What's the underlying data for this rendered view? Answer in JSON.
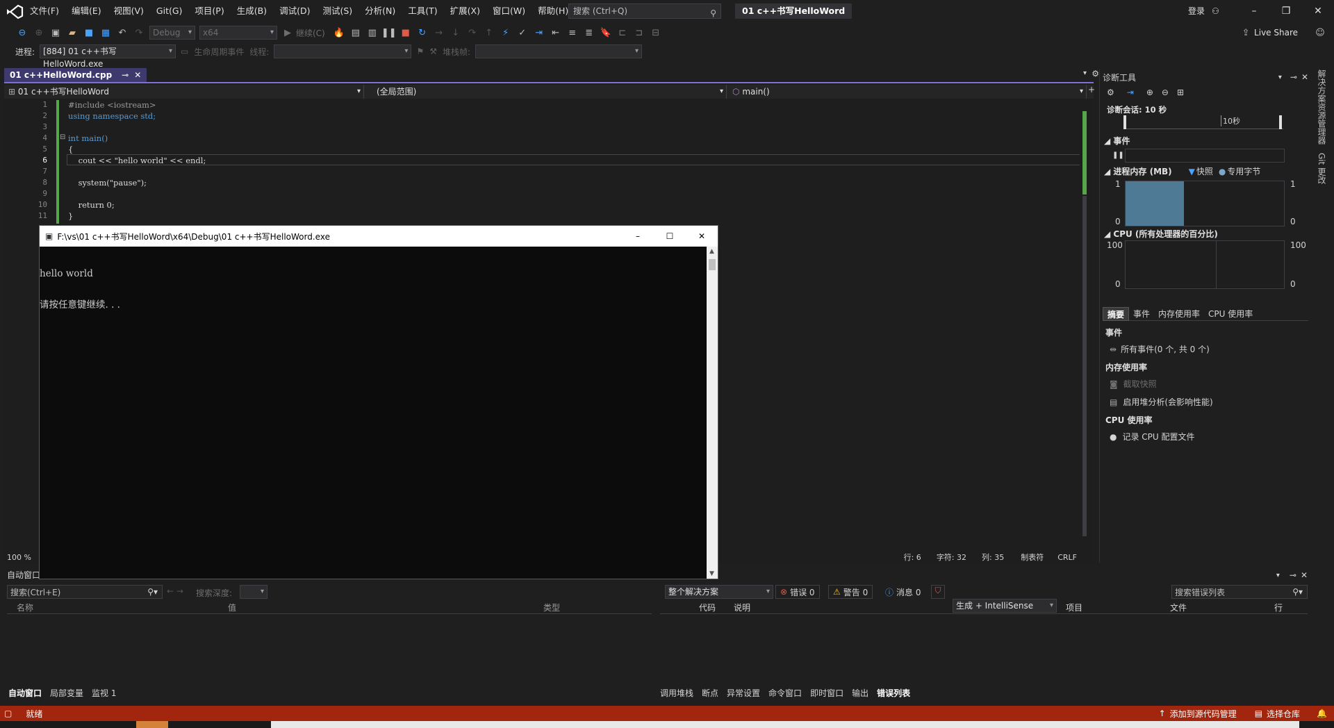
{
  "titlebar": {
    "menu": [
      "文件(F)",
      "编辑(E)",
      "视图(V)",
      "Git(G)",
      "项目(P)",
      "生成(B)",
      "调试(D)",
      "测试(S)",
      "分析(N)",
      "工具(T)",
      "扩展(X)",
      "窗口(W)",
      "帮助(H)"
    ],
    "search_placeholder": "搜索 (Ctrl+Q)",
    "solution_name": "01 c++书写HelloWord",
    "login": "登录"
  },
  "toolbar": {
    "config": "Debug",
    "platform": "x64",
    "continue_label": "继续(C)",
    "live_share": "Live Share",
    "process_label": "进程:",
    "process_value": "[884] 01 c++书写HelloWord.exe",
    "lifecycle_label": "生命周期事件",
    "thread_label": "线程:",
    "stackframe_label": "堆栈帧:"
  },
  "editor": {
    "tab_title": "01 c++HelloWord.cpp",
    "nav_project": "01 c++书写HelloWord",
    "nav_scope": "(全局范围)",
    "nav_member": "main()",
    "lines": [
      {
        "n": "1",
        "text": "#include <iostream>"
      },
      {
        "n": "2",
        "text": "using namespace std;"
      },
      {
        "n": "3",
        "text": ""
      },
      {
        "n": "4",
        "text": "int main()"
      },
      {
        "n": "5",
        "text": "{"
      },
      {
        "n": "6",
        "text": "    cout << \"hello world\" << endl;"
      },
      {
        "n": "7",
        "text": ""
      },
      {
        "n": "8",
        "text": "    system(\"pause\");"
      },
      {
        "n": "9",
        "text": ""
      },
      {
        "n": "10",
        "text": "    return 0;"
      },
      {
        "n": "11",
        "text": "}"
      }
    ],
    "zoom": "100 %",
    "status": {
      "line": "行: 6",
      "char": "字符: 32",
      "col": "列: 35",
      "tabs": "制表符",
      "eol": "CRLF"
    }
  },
  "console": {
    "title": "F:\\vs\\01 c++书写HelloWord\\x64\\Debug\\01 c++书写HelloWord.exe",
    "output_line1": "hello world",
    "output_line2": "请按任意键继续. . ."
  },
  "diagnostics": {
    "title": "诊断工具",
    "session": "诊断会话: 10 秒",
    "timeline_mark": "10秒",
    "events_header": "事件",
    "memory_header": "进程内存 (MB)",
    "legend_snapshot": "快照",
    "legend_private": "专用字节",
    "mem_ymax": "1",
    "mem_ymin": "0",
    "cpu_header": "CPU (所有处理器的百分比)",
    "cpu_ymax": "100",
    "cpu_ymin": "0",
    "mem_fill_fraction": 0.37,
    "tabs": [
      "摘要",
      "事件",
      "内存使用率",
      "CPU 使用率"
    ],
    "summary": {
      "events_title": "事件",
      "all_events": "所有事件(0 个, 共 0 个)",
      "memory_title": "内存使用率",
      "take_snapshot": "截取快照",
      "heap_analysis": "启用堆分析(会影响性能)",
      "cpu_title": "CPU 使用率",
      "record_cpu": "记录 CPU 配置文件"
    }
  },
  "autos": {
    "title": "自动窗口",
    "search_placeholder": "搜索(Ctrl+E)",
    "depth_label": "搜索深度:",
    "columns": [
      "名称",
      "值",
      "类型"
    ],
    "tabs": [
      "自动窗口",
      "局部变量",
      "监视 1"
    ]
  },
  "errors": {
    "scope": "整个解决方案",
    "errors_label": "错误 0",
    "warnings_label": "警告 0",
    "messages_label": "消息 0",
    "build_filter": "生成 + IntelliSense",
    "search_placeholder": "搜索错误列表",
    "columns": [
      "代码",
      "说明",
      "项目",
      "文件",
      "行"
    ],
    "tabs": [
      "调用堆栈",
      "断点",
      "异常设置",
      "命令窗口",
      "即时窗口",
      "输出",
      "错误列表"
    ]
  },
  "side_strip": {
    "solution_explorer": "解决方案资源管理器",
    "git_changes": "Git 更改"
  },
  "statusbar": {
    "ready": "就绪",
    "add_source_control": "添加到源代码管理",
    "select_repo": "选择仓库"
  },
  "colors": {
    "accent": "#7f6fd6",
    "statusbar": "#a1260d",
    "green_change": "#57a64a",
    "memory_fill": "#4e7a96"
  }
}
